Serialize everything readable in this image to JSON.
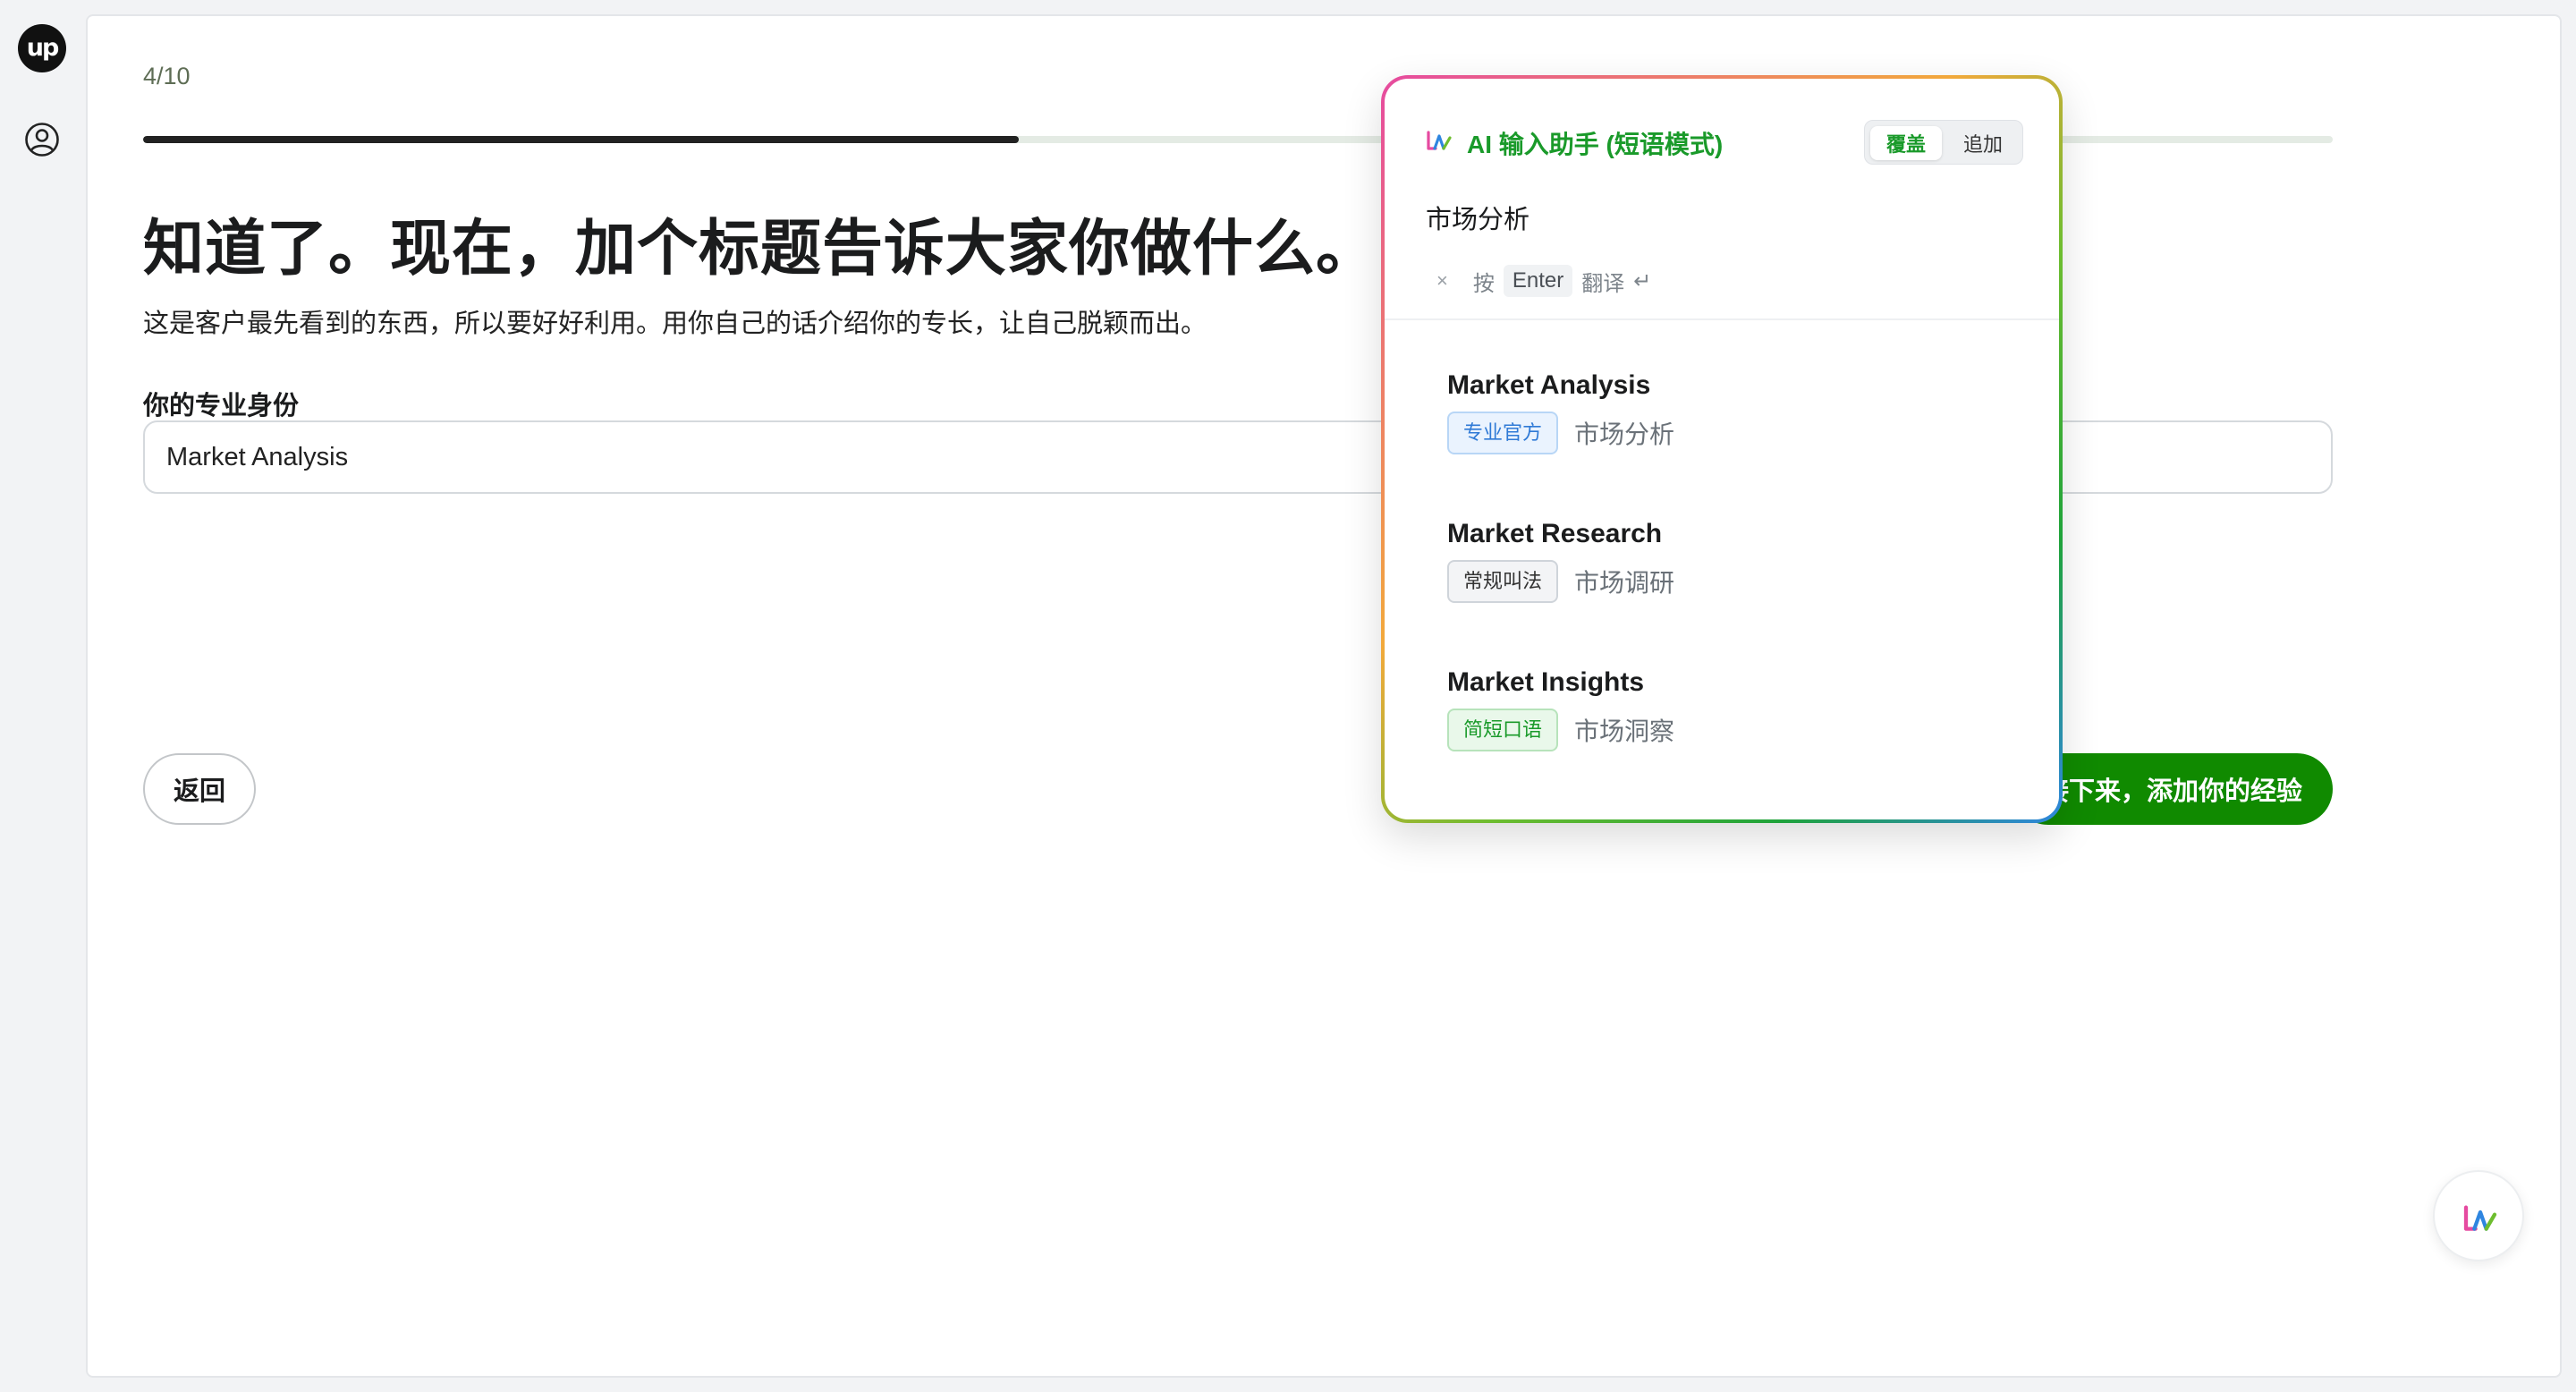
{
  "sidebar": {
    "logo_text": "up",
    "profile_icon": "user-circle-icon"
  },
  "main": {
    "step": "4/10",
    "progress": 0.4,
    "headline": "知道了。现在，加个标题告诉大家你做什么。",
    "subtitle": "这是客户最先看到的东西，所以要好好利用。用你自己的话介绍你的专长，让自己脱颖而出。",
    "field_label": "你的专业身份",
    "field_value": "Market Analysis",
    "back_label": "返回",
    "next_label": "接下来，添加你的经验"
  },
  "ai_popup": {
    "title": "AI 输入助手 (短语模式)",
    "mode_overwrite": "覆盖",
    "mode_append": "追加",
    "query": "市场分析",
    "close": "×",
    "hint_press": "按",
    "hint_key": "Enter",
    "hint_action": "翻译",
    "hint_symbol": "↵",
    "suggestions": [
      {
        "en": "Market Analysis",
        "tag": "专业官方",
        "cn": "市场分析"
      },
      {
        "en": "Market Research",
        "tag": "常规叫法",
        "cn": "市场调研"
      },
      {
        "en": "Market Insights",
        "tag": "简短口语",
        "cn": "市场洞察"
      }
    ]
  },
  "colors": {
    "brand_green": "#108a00",
    "ai_green": "#1a9a2a",
    "progress_fill": "#222222"
  }
}
